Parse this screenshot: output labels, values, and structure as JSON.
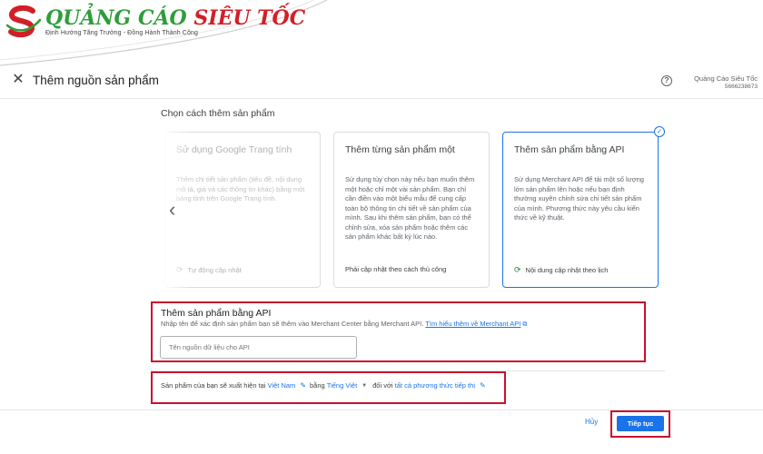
{
  "logo": {
    "brand_green": "QUẢNG CÁO",
    "brand_red": "SIÊU TỐC",
    "tagline": "Định Hướng Tăng Trưởng - Đồng Hành Thành Công"
  },
  "header": {
    "title": "Thêm nguồn sản phẩm",
    "account_name": "Quảng Cáo Siêu Tốc",
    "account_id": "5666238673"
  },
  "section_title": "Chọn cách thêm sản phẩm",
  "cards": [
    {
      "title": "Sử dụng Google Trang tính",
      "desc": "Thêm chi tiết sản phẩm (tiêu đề, nội dung mô tả, giá và các thông tin khác) bằng một bảng tính trên Google Trang tính.",
      "footer": "Tự động cập nhật",
      "footer_icon": "sync-icon"
    },
    {
      "title": "Thêm từng sản phẩm một",
      "desc": "Sử dụng tùy chọn này nếu bạn muốn thêm một hoặc chỉ một vài sản phẩm. Bạn chỉ cần điền vào một biểu mẫu để cung cấp toàn bộ thông tin chi tiết về sản phẩm của mình. Sau khi thêm sản phẩm, bạn có thể chỉnh sửa, xóa sản phẩm hoặc thêm các sản phẩm khác bất kỳ lúc nào.",
      "footer": "Phải cập nhật theo cách thủ công"
    },
    {
      "title": "Thêm sản phẩm bằng API",
      "desc": "Sử dụng Merchant API để tải một số lượng lớn sản phẩm lên hoặc nếu bạn định thường xuyên chỉnh sửa chi tiết sản phẩm của mình. Phương thức này yêu cầu kiến thức về kỹ thuật.",
      "footer": "Nội dung cập nhật theo lịch",
      "footer_icon": "sync-icon"
    }
  ],
  "api_section": {
    "title": "Thêm sản phẩm bằng API",
    "desc": "Nhập tên để xác định sản phẩm bạn sẽ thêm vào Merchant Center bằng Merchant API.",
    "link": "Tìm hiểu thêm về Merchant API",
    "input_placeholder": "Tên nguồn dữ liệu cho API",
    "input_value": ""
  },
  "sentence": {
    "prefix": "Sản phẩm của bạn sẽ xuất hiện tại",
    "country": "Việt Nam",
    "lang_prefix": "bằng",
    "language": "Tiếng Việt",
    "channel_prefix": "đối với",
    "channel": "tất cả phương thức tiếp thị"
  },
  "footer": {
    "cancel": "Hủy",
    "continue": "Tiếp tục"
  },
  "colors": {
    "accent": "#1a73e8",
    "highlight_box": "#c8102e",
    "brand_green": "#2e9d3a",
    "brand_red": "#d21f26"
  }
}
